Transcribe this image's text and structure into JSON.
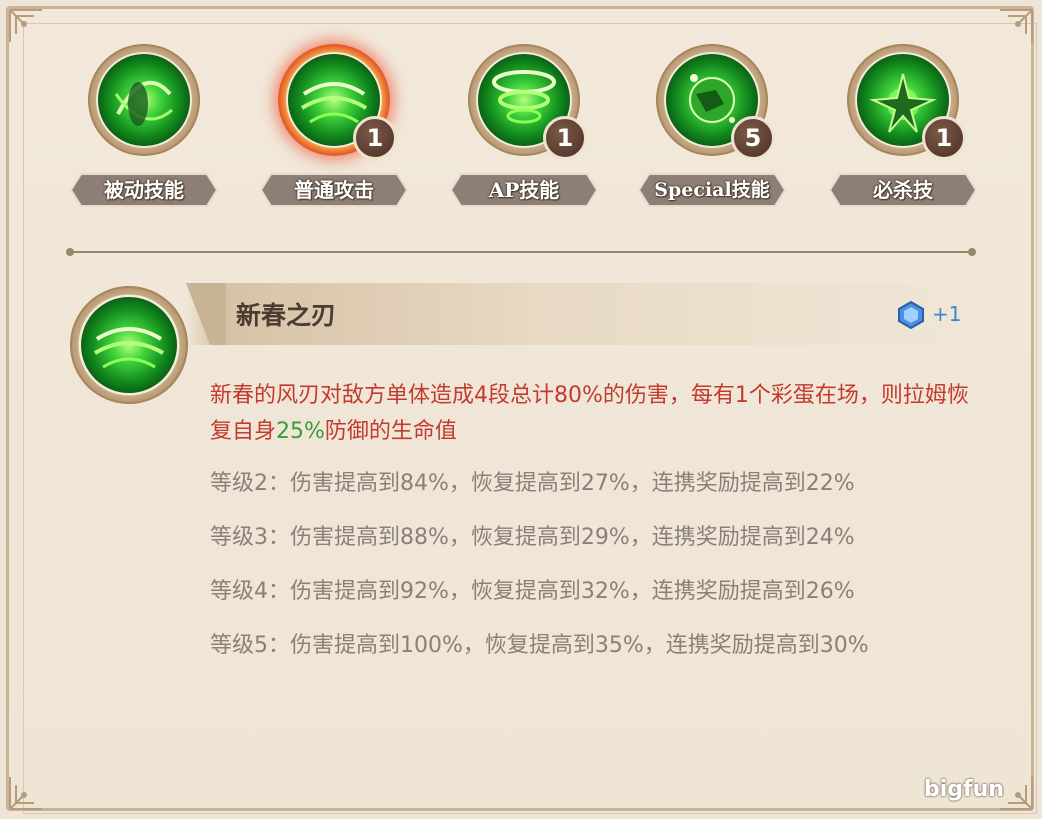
{
  "skills": [
    {
      "label": "被动技能",
      "badge": null,
      "icon": "passive-skill-icon"
    },
    {
      "label": "普通攻击",
      "badge": "1",
      "icon": "normal-attack-icon"
    },
    {
      "label": "AP技能",
      "badge": "1",
      "icon": "ap-skill-icon"
    },
    {
      "label": "Special技能",
      "badge": "5",
      "icon": "special-skill-icon"
    },
    {
      "label": "必杀技",
      "badge": "1",
      "icon": "ultimate-skill-icon"
    }
  ],
  "selected_skill_index": 1,
  "detail": {
    "title": "新春之刃",
    "gem_bonus": "+1",
    "desc_part1": "新春的风刃对敌方单体造成4段总计",
    "desc_pct1": "80%",
    "desc_part2": "的伤害，每有1个彩蛋在场，则拉姆恢复自身",
    "desc_pct2": "25%",
    "desc_part3": "防御的生命值",
    "levels": [
      "等级2：伤害提高到84%，恢复提高到27%，连携奖励提高到22%",
      "等级3：伤害提高到88%，恢复提高到29%，连携奖励提高到24%",
      "等级4：伤害提高到92%，恢复提高到32%，连携奖励提高到26%",
      "等级5：伤害提高到100%，恢复提高到35%，连携奖励提高到30%"
    ]
  },
  "watermark": "bigfun",
  "colors": {
    "red_text": "#c43a2e",
    "green_text": "#3d9b3a",
    "gray_text": "#8a8078",
    "badge": "#5a3a2c",
    "gem": "#3a86d6"
  }
}
